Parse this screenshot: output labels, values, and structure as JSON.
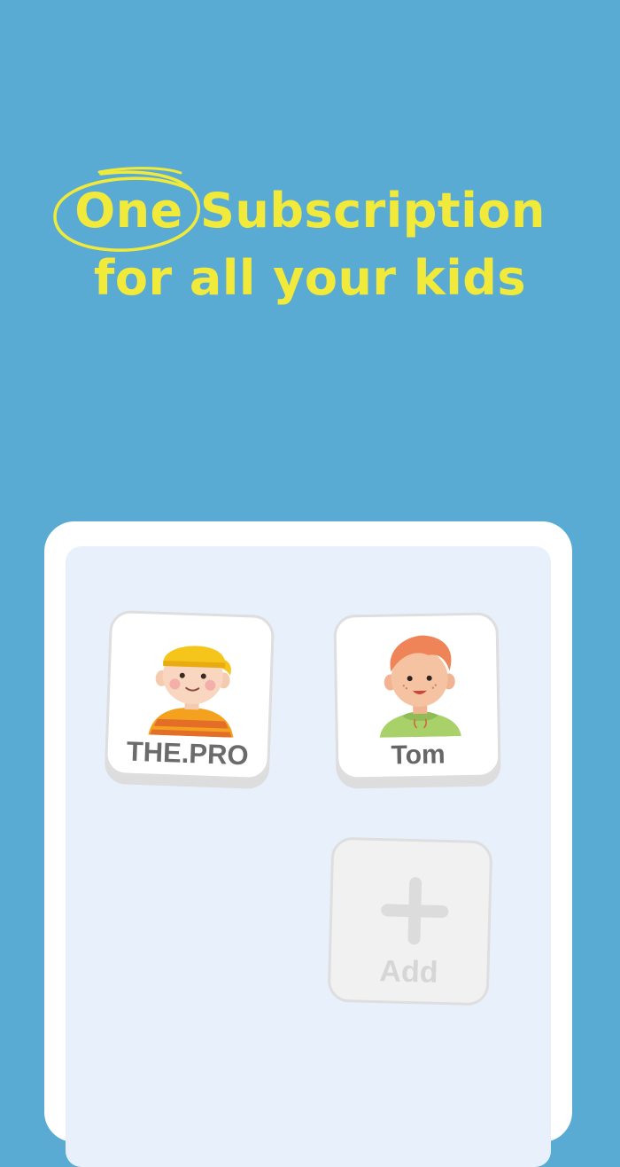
{
  "headline": {
    "highlight": "One",
    "rest_line1": " Subscription",
    "line2": "for all your kids"
  },
  "profiles": [
    {
      "name": "THE.PRO",
      "avatar_icon": "boy-yellow-cap-avatar-icon"
    },
    {
      "name": "Tom",
      "avatar_icon": "boy-red-hair-hoodie-avatar-icon"
    }
  ],
  "add_card": {
    "label": "Add",
    "icon": "plus-icon"
  },
  "colors": {
    "background": "#5aabd3",
    "headline": "#f1ea3b",
    "screen": "#e8f1fb",
    "card_text": "#6b6b6b"
  }
}
